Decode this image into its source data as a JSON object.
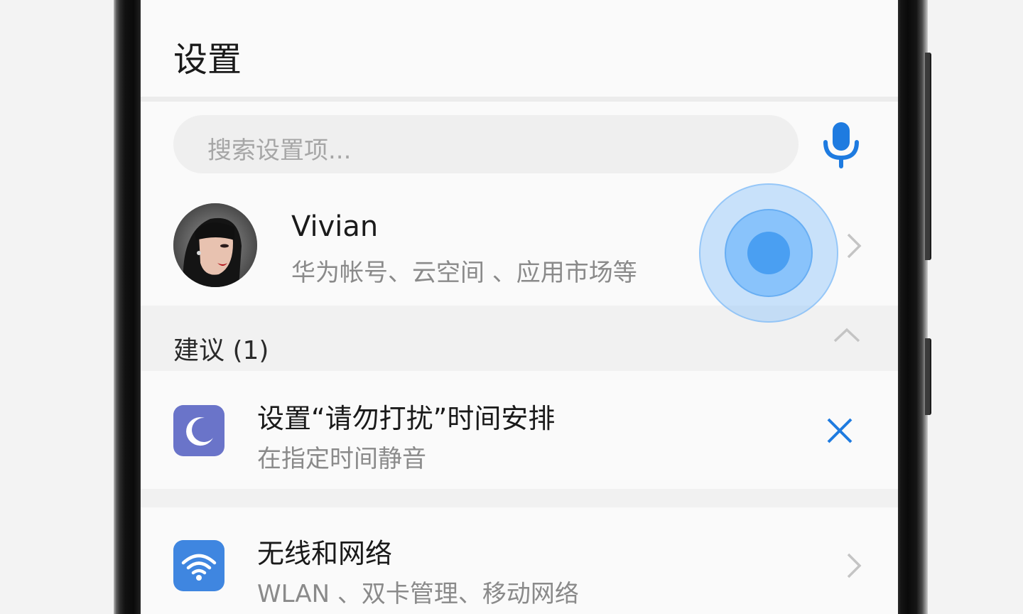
{
  "page_title": "设置",
  "search": {
    "placeholder": "搜索设置项..."
  },
  "account": {
    "name": "Vivian",
    "subtitle": "华为帐号、云空间 、应用市场等"
  },
  "suggestions": {
    "header": "建议 (1)",
    "items": [
      {
        "title": "设置“请勿打扰”时间安排",
        "subtitle": "在指定时间静音",
        "icon": "moon-icon"
      }
    ]
  },
  "settings_items": [
    {
      "title": "无线和网络",
      "subtitle": "WLAN 、双卡管理、移动网络",
      "icon": "wifi-icon"
    }
  ],
  "colors": {
    "accent": "#1e7be0",
    "moon_icon_bg": "#6a74c9",
    "wifi_icon_bg": "#3f86e0",
    "touch_indicator": "#4a9ff2"
  }
}
